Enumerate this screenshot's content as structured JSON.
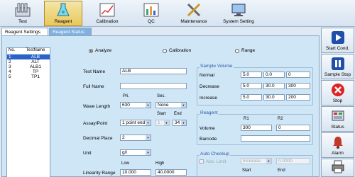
{
  "toolbar": {
    "items": [
      {
        "label": "Test",
        "icon": "test-tubes-icon"
      },
      {
        "label": "Reagent",
        "icon": "flask-icon"
      },
      {
        "label": "Calibration",
        "icon": "calibration-chart-icon"
      },
      {
        "label": "QC",
        "icon": "qc-chart-icon"
      },
      {
        "label": "Maintenance",
        "icon": "tools-icon"
      },
      {
        "label": "System Setting",
        "icon": "computer-settings-icon"
      }
    ],
    "active": "Reagent"
  },
  "tabs": [
    {
      "label": "Reagent Settings",
      "active": true
    },
    {
      "label": "Reagent Status",
      "active": false
    }
  ],
  "list": {
    "headers": [
      "No.",
      "TestName"
    ],
    "rows": [
      {
        "no": "1",
        "name": "ALB"
      },
      {
        "no": "2",
        "name": "ALT"
      },
      {
        "no": "3",
        "name": "ALB1"
      },
      {
        "no": "4",
        "name": "TP"
      },
      {
        "no": "5",
        "name": "TP1"
      }
    ],
    "selected_index": 0
  },
  "mode": {
    "options": [
      "Analyze",
      "Calibration",
      "Range"
    ],
    "selected": "Analyze"
  },
  "form": {
    "test_name_label": "Test Name",
    "test_name_value": "ALB",
    "full_name_label": "Full Name",
    "full_name_value": "",
    "pri_label": "Pri.",
    "sec_label": "Sec.",
    "wave_length_label": "Wave Length",
    "wave_pri": "630",
    "wave_sec": "None",
    "start_label": "Start",
    "end_label": "End",
    "assay_label": "Assay/Point",
    "assay_value": "1 point end",
    "assay_start": "1",
    "assay_end": "34",
    "decimal_label": "Decimal Place",
    "decimal_value": "2",
    "unit_label": "Unit",
    "unit_value": "g/l",
    "low_label": "Low",
    "high_label": "High",
    "linearity_label": "Linearity Range",
    "linearity_low": "10.000",
    "linearity_high": "40.0000"
  },
  "sample_volume": {
    "title": "Sample Volume",
    "rows": [
      {
        "label": "Normal",
        "values": [
          "5.0",
          "0.0",
          "0"
        ]
      },
      {
        "label": "Decrease",
        "values": [
          "5.0",
          "30.0",
          "300"
        ]
      },
      {
        "label": "Increase",
        "values": [
          "5.0",
          "30.0",
          "200"
        ]
      }
    ]
  },
  "reagent": {
    "title": "Reagent",
    "r1_label": "R1",
    "r2_label": "R2",
    "volume_label": "Volume",
    "volume_r1": "300",
    "volume_r2": "0",
    "barcode_label": "Barcode",
    "barcode_value": ""
  },
  "auto_checkup": {
    "title": "Auto Checkup",
    "abs_limit_label": "Abs. Limit",
    "abs_limit_mode": "Increase",
    "abs_limit_value": "0.0000",
    "start_label": "Start",
    "end_label": "End"
  },
  "side_buttons": [
    {
      "label": "Start Cond.",
      "icon": "play-icon"
    },
    {
      "label": "Sample Stop",
      "icon": "pause-icon"
    },
    {
      "label": "Stop",
      "icon": "stop-icon"
    },
    {
      "label": "Status",
      "icon": "status-monitor-icon"
    },
    {
      "label": "Alarm",
      "icon": "alarm-bell-icon"
    },
    {
      "label": "",
      "icon": "printer-icon"
    }
  ]
}
